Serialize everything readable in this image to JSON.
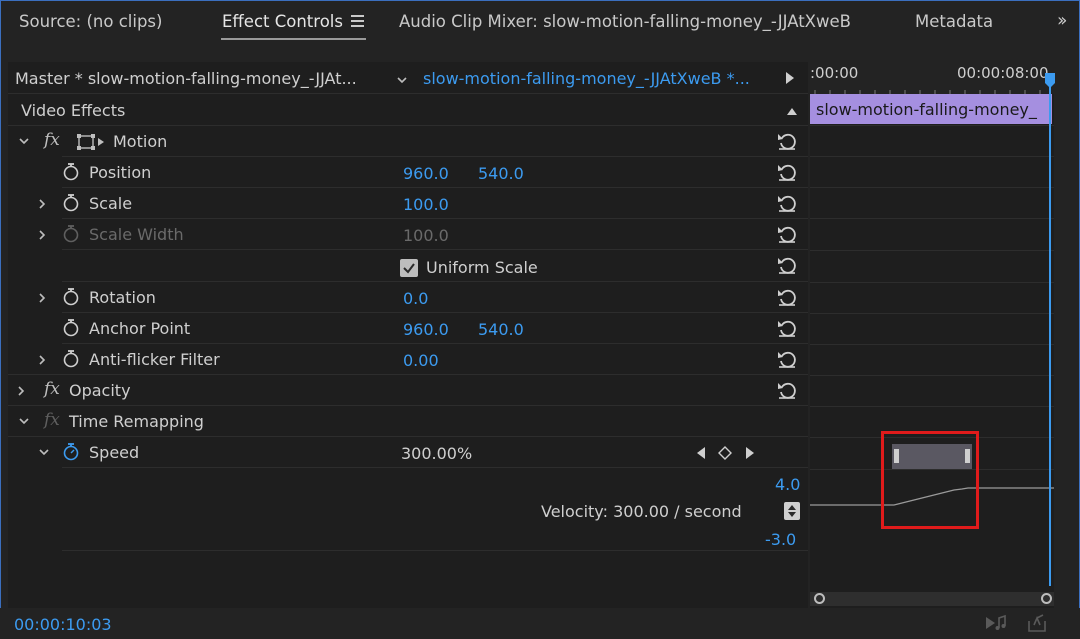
{
  "tabs": [
    {
      "label": "Source: (no clips)"
    },
    {
      "label": "Effect Controls"
    },
    {
      "label": "Audio Clip Mixer: slow-motion-falling-money_-JJAtXweB"
    },
    {
      "label": "Metadata"
    }
  ],
  "header": {
    "master_label": "Master * slow-motion-falling-money_-JJAt...",
    "clip_label": "slow-motion-falling-money_-JJAtXweB *..."
  },
  "timeline": {
    "time_start": ":00:00",
    "time_end": "00:00:08:00",
    "clip_name": "slow-motion-falling-money_"
  },
  "effects": {
    "section_title": "Video Effects",
    "motion": {
      "label": "Motion",
      "position": {
        "label": "Position",
        "x": "960.0",
        "y": "540.0"
      },
      "scale": {
        "label": "Scale",
        "value": "100.0"
      },
      "scale_width": {
        "label": "Scale Width",
        "value": "100.0"
      },
      "uniform_scale": {
        "label": "Uniform Scale",
        "checked": true
      },
      "rotation": {
        "label": "Rotation",
        "value": "0.0"
      },
      "anchor_point": {
        "label": "Anchor Point",
        "x": "960.0",
        "y": "540.0"
      },
      "anti_flicker": {
        "label": "Anti-flicker Filter",
        "value": "0.00"
      }
    },
    "opacity": {
      "label": "Opacity"
    },
    "time_remapping": {
      "label": "Time Remapping",
      "speed": {
        "label": "Speed",
        "value": "300.00%"
      },
      "graph_max": "4.0",
      "graph_min": "-3.0",
      "velocity": "Velocity: 300.00 / second"
    }
  },
  "footer": {
    "timecode": "00:00:10:03"
  },
  "colors": {
    "accent_blue": "#3c9bf0",
    "clip_purple": "#a58fe0",
    "highlight_red": "#e01b1b"
  }
}
